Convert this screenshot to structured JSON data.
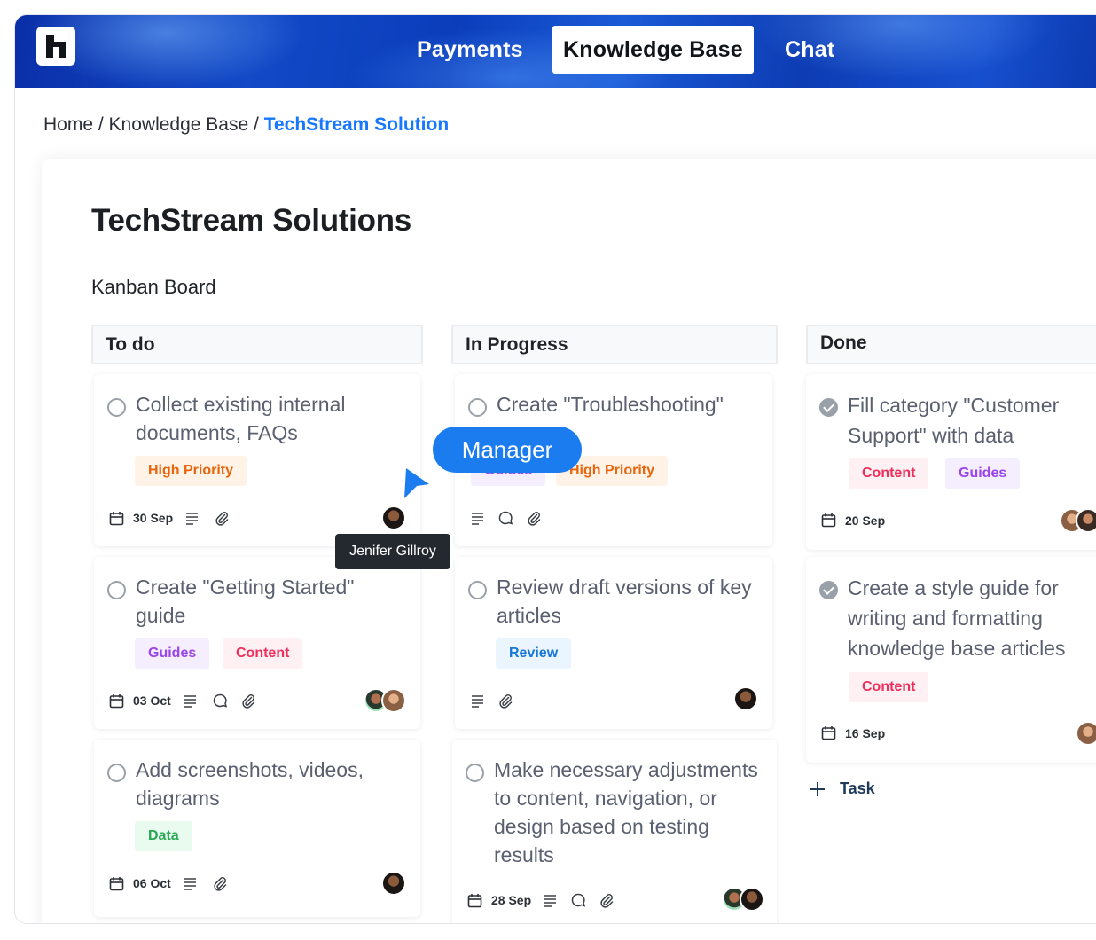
{
  "nav": {
    "items": [
      {
        "label": "Payments",
        "active": false
      },
      {
        "label": "Knowledge Base",
        "active": true
      },
      {
        "label": "Chat",
        "active": false
      }
    ]
  },
  "breadcrumb": {
    "home": "Home",
    "sep1": " / ",
    "section": "Knowledge Base",
    "sep2": " / ",
    "current": "TechStream Solution"
  },
  "page": {
    "title": "TechStream Solutions",
    "board_label": "Kanban Board"
  },
  "columns": {
    "todo": {
      "name": "To do",
      "cards": [
        {
          "title": "Collect existing internal documents, FAQs",
          "tags": [
            "High Priority"
          ],
          "date": "30 Sep"
        },
        {
          "title": "Create \"Getting Started\" guide",
          "tags": [
            "Guides",
            "Content"
          ],
          "date": "03 Oct"
        },
        {
          "title": "Add screenshots, videos, diagrams",
          "tags": [
            "Data"
          ],
          "date": "06 Oct"
        }
      ]
    },
    "progress": {
      "name": "In Progress",
      "cards": [
        {
          "title": "Create \"Troubleshooting\"",
          "tags": [
            "Guides",
            "High Priority"
          ]
        },
        {
          "title": "Review draft versions of key articles",
          "tags": [
            "Review"
          ]
        },
        {
          "title": "Make necessary adjustments to content, navigation, or design based on testing results",
          "date": "28 Sep"
        }
      ]
    },
    "done": {
      "name": "Done",
      "cards": [
        {
          "title": "Fill category \"Customer Support\" with data",
          "tags": [
            "Content",
            "Guides"
          ],
          "date": "20 Sep"
        },
        {
          "title": "Create a style guide for writing and formatting knowledge base articles",
          "tags": [
            "Content"
          ],
          "date": "16 Sep"
        }
      ],
      "add_task": "Task"
    }
  },
  "overlay": {
    "manager_badge": "Manager",
    "tooltip": "Jenifer Gillroy"
  },
  "colors": {
    "accent": "#1677ff",
    "nav_bg": "#1249c6"
  }
}
